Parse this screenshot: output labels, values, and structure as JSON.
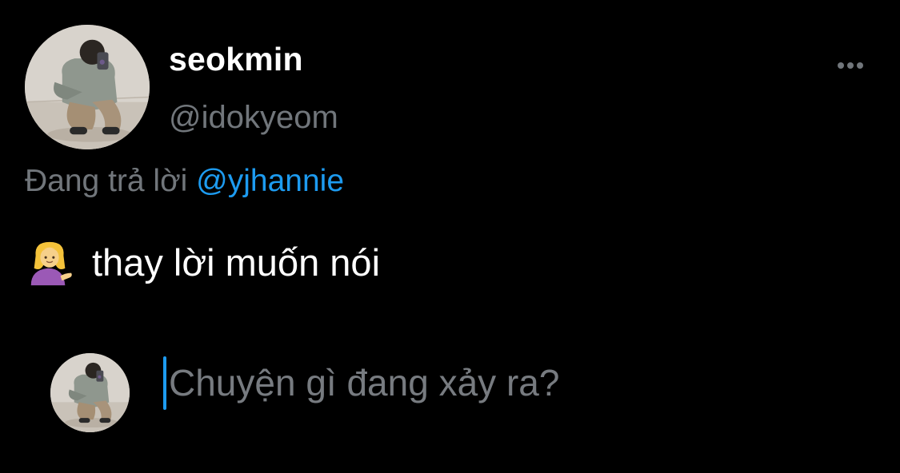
{
  "tweet": {
    "author": {
      "display_name": "seokmin",
      "handle": "@idokyeom",
      "avatar_icon": "avatar-photo"
    },
    "more_icon": "more-horizontal-icon",
    "reply_context": {
      "prefix": "Đang trả lời",
      "mention": "@yjhannie"
    },
    "text": {
      "emoji_icon": "tipping-hand-woman-emoji",
      "body": "thay lời muốn nói"
    }
  },
  "composer": {
    "placeholder": "Chuyện gì đang xảy ra?",
    "avatar_icon": "avatar-photo"
  },
  "colors": {
    "background": "#000000",
    "primary_text": "#ffffff",
    "secondary_text": "#71767b",
    "accent": "#1d9bf0"
  }
}
